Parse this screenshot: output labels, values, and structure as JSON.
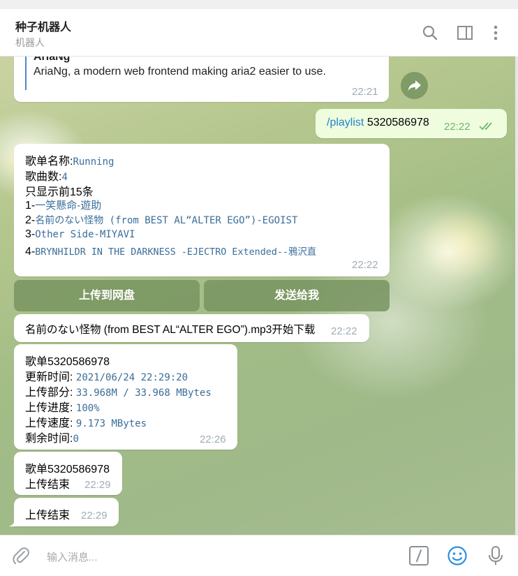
{
  "header": {
    "title": "种子机器人",
    "subtitle": "机器人",
    "icons": [
      "search-icon",
      "sidebar-toggle-icon",
      "more-vertical-icon"
    ]
  },
  "messages": {
    "quote": {
      "title": "AriaNg",
      "text": "AriaNg, a modern web frontend making aria2 easier to use.",
      "time": "22:21"
    },
    "command": {
      "command": "/playlist",
      "arg": "5320586978",
      "time": "22:22"
    },
    "playlist": {
      "name_label": "歌单名称:",
      "name_value": "Running",
      "count_label": "歌曲数:",
      "count_value": "4",
      "limit_text": "只显示前15条",
      "items": [
        {
          "num": "1-",
          "text": "一笑懸命-遊助"
        },
        {
          "num": "2-",
          "text": "名前のない怪物 (from BEST AL“ALTER EGO”)-EGOIST"
        },
        {
          "num": "3-",
          "text": "Other Side-MIYAVI"
        },
        {
          "num": "4-",
          "text": "BRYNHILDR IN THE DARKNESS -EJECTRO Extended--鴉沢直"
        }
      ],
      "time": "22:22"
    },
    "buttons": {
      "upload": "上传到网盘",
      "send": "发送给我"
    },
    "download": {
      "text": "名前のない怪物 (from BEST AL“ALTER EGO”).mp3开始下载",
      "time": "22:22"
    },
    "progress": {
      "title": "歌单5320586978",
      "update_label": "更新时间:",
      "update_value": "2021/06/24 22:29:20",
      "part_label": "上传部分:",
      "part_value": "33.968M / 33.968 MBytes",
      "pct_label": "上传进度:",
      "pct_value": "100%",
      "speed_label": "上传速度:",
      "speed_value": "9.173 MBytes",
      "remain_label": "剩余时间:",
      "remain_value": "0",
      "time": "22:26"
    },
    "finished1": {
      "title": "歌单5320586978",
      "text": "上传结束",
      "time": "22:29"
    },
    "finished2": {
      "text": "上传结束",
      "time": "22:29"
    }
  },
  "input": {
    "placeholder": "输入消息...",
    "icons": [
      "attach-icon",
      "command-icon",
      "emoji-icon",
      "microphone-icon"
    ]
  },
  "colors": {
    "accent": "#2481cc",
    "keyboard_button": "#78945f",
    "outgoing_bubble": "#effdde",
    "read_ticks": "#6fb66a"
  }
}
